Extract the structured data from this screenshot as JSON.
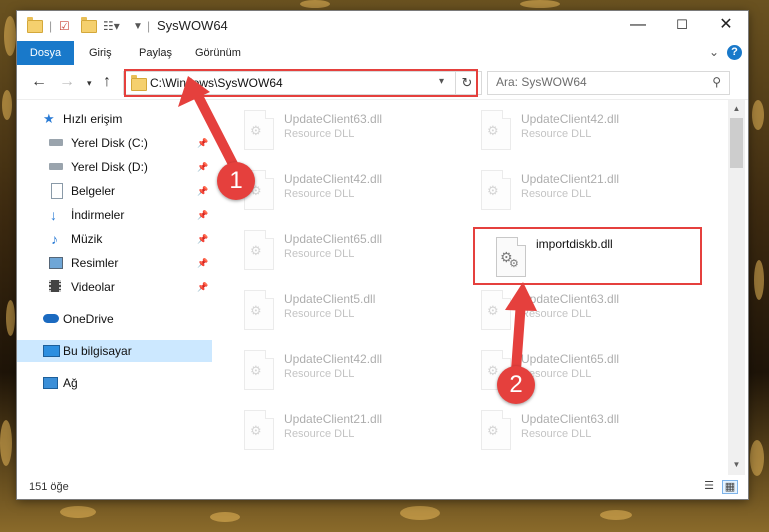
{
  "window": {
    "title": "SysWOW64"
  },
  "ribbon": {
    "tabs": [
      "Dosya",
      "Giriş",
      "Paylaş",
      "Görünüm"
    ],
    "help": "?"
  },
  "address": {
    "path": "C:\\Windows\\SysWOW64"
  },
  "search": {
    "placeholder": "Ara: SysWOW64"
  },
  "nav": {
    "quick_access": "Hızlı erişim",
    "items": [
      "Yerel Disk (C:)",
      "Yerel Disk (D:)",
      "Belgeler",
      "İndirmeler",
      "Müzik",
      "Resimler",
      "Videolar"
    ],
    "onedrive": "OneDrive",
    "this_pc": "Bu bilgisayar",
    "network": "Ağ"
  },
  "files": {
    "type_label": "Resource DLL",
    "left": [
      "UpdateClient63.dll",
      "UpdateClient42.dll",
      "UpdateClient65.dll",
      "UpdateClient5.dll",
      "UpdateClient42.dll",
      "UpdateClient21.dll"
    ],
    "right": [
      "UpdateClient42.dll",
      "UpdateClient21.dll",
      "importdiskb.dll",
      "UpdateClient63.dll",
      "UpdateClient65.dll",
      "UpdateClient63.dll"
    ]
  },
  "status": {
    "count": "151 öğe"
  },
  "annotations": {
    "step1": "1",
    "step2": "2"
  },
  "colors": {
    "accent": "#1979ca",
    "highlight": "#e5403d",
    "selected": "#cce8ff"
  }
}
